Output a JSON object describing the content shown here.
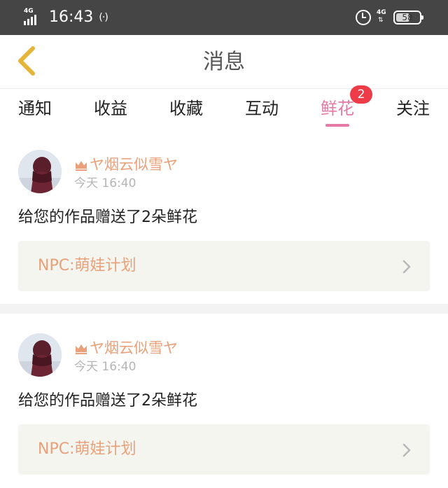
{
  "status_bar": {
    "signal_label": "4G",
    "time": "16:43",
    "nfc_glyph": "(·)",
    "right_network_label": "4G",
    "right_network_glyph": "⇅",
    "battery_percent": "58",
    "battery_level": 0.58,
    "icons": [
      "signal-icon",
      "nfc-icon",
      "alarm-icon",
      "network-icon",
      "battery-icon"
    ]
  },
  "nav": {
    "title": "消息",
    "back_icon": "chevron-left-icon",
    "back_color": "#e5b53a"
  },
  "tabs": [
    {
      "label": "通知",
      "active": false
    },
    {
      "label": "收益",
      "active": false
    },
    {
      "label": "收藏",
      "active": false
    },
    {
      "label": "互动",
      "active": false
    },
    {
      "label": "鲜花",
      "active": true,
      "badge": "2"
    },
    {
      "label": "关注",
      "active": false
    }
  ],
  "messages": [
    {
      "username": "ヤ烟云似雪ヤ",
      "time": "今天 16:40",
      "text": "给您的作品赠送了2朵鲜花",
      "work_title": "NPC:萌娃计划",
      "avatar_icon": "avatar",
      "rank_icon": "crown-icon"
    },
    {
      "username": "ヤ烟云似雪ヤ",
      "time": "今天 16:40",
      "text": "给您的作品赠送了2朵鲜花",
      "work_title": "NPC:萌娃计划",
      "avatar_icon": "avatar",
      "rank_icon": "crown-icon"
    }
  ],
  "colors": {
    "accent_pink": "#e47aa5",
    "badge_red": "#ee3b48",
    "username_orange": "#e8a17a",
    "card_bg": "#f5f5ef",
    "status_bar_bg": "#454545"
  }
}
